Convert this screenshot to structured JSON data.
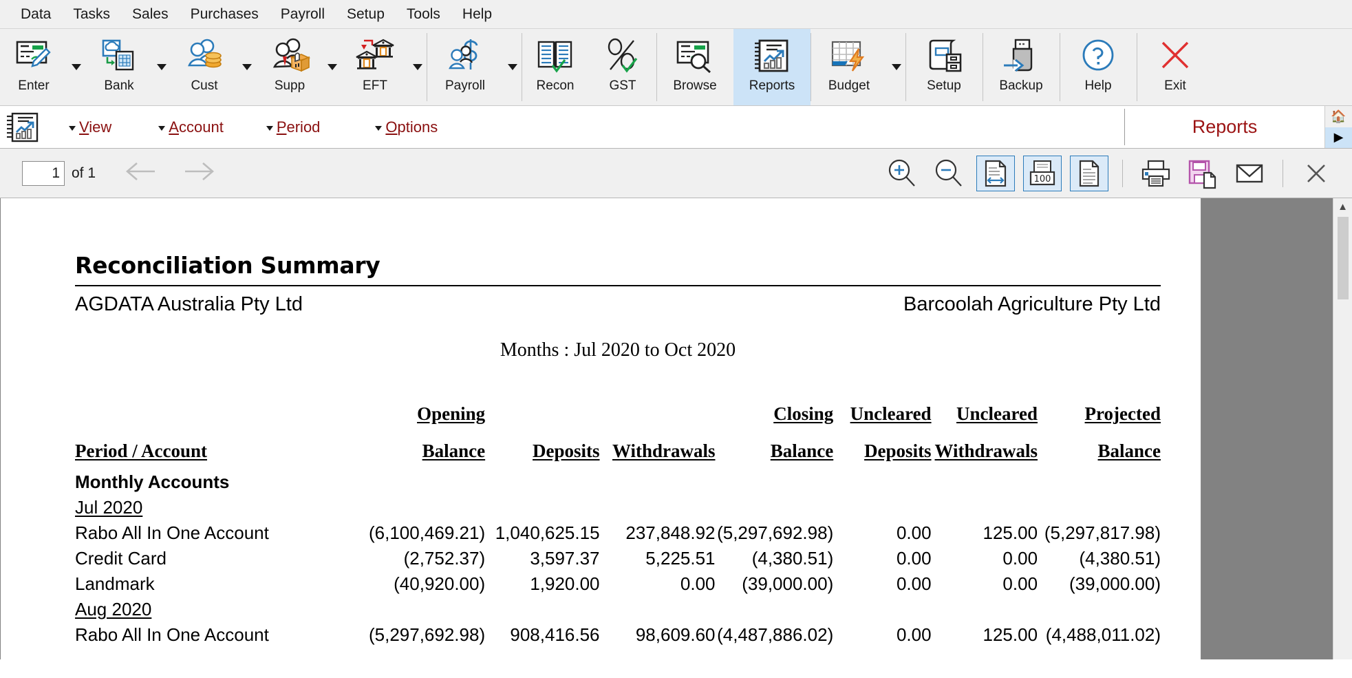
{
  "menubar": {
    "items": [
      {
        "label": "Data"
      },
      {
        "label": "Tasks"
      },
      {
        "label": "Sales"
      },
      {
        "label": "Purchases"
      },
      {
        "label": "Payroll"
      },
      {
        "label": "Setup"
      },
      {
        "label": "Tools"
      },
      {
        "label": "Help"
      }
    ]
  },
  "ribbon": {
    "buttons": [
      {
        "label": "Enter",
        "icon": "cheque-pencil-icon",
        "caret": true,
        "active": false
      },
      {
        "label": "Bank",
        "icon": "cloud-spreadsheet-icon",
        "caret": true,
        "active": false
      },
      {
        "label": "Cust",
        "icon": "people-coins-icon",
        "caret": true,
        "active": false
      },
      {
        "label": "Supp",
        "icon": "person-box-icon",
        "caret": true,
        "active": false
      },
      {
        "label": "EFT",
        "icon": "bank-transfer-icon",
        "caret": true,
        "active": false
      },
      {
        "label": "Payroll",
        "icon": "dollar-person-icon",
        "caret": true,
        "active": false
      },
      {
        "label": "Recon",
        "icon": "book-check-icon",
        "caret": false,
        "active": false
      },
      {
        "label": "GST",
        "icon": "percent-check-icon",
        "caret": false,
        "active": false
      },
      {
        "label": "Browse",
        "icon": "cheque-magnifier-icon",
        "caret": false,
        "active": false
      },
      {
        "label": "Reports",
        "icon": "report-chart-icon",
        "caret": false,
        "active": true
      },
      {
        "label": "Budget",
        "icon": "grid-lightning-icon",
        "caret": true,
        "active": false
      },
      {
        "label": "Setup",
        "icon": "book-cabinet-icon",
        "caret": false,
        "active": false
      },
      {
        "label": "Backup",
        "icon": "usb-arrow-icon",
        "caret": false,
        "active": false
      },
      {
        "label": "Help",
        "icon": "question-circle-icon",
        "caret": false,
        "active": false
      },
      {
        "label": "Exit",
        "icon": "close-x-icon",
        "caret": false,
        "active": false
      }
    ],
    "accent_blue": "#2b7bba",
    "active_bg": "#cce3f7"
  },
  "submenu": {
    "items": [
      {
        "mnemonic": "V",
        "rest": "iew"
      },
      {
        "mnemonic": "A",
        "rest": "ccount"
      },
      {
        "mnemonic": "P",
        "rest": "eriod"
      },
      {
        "mnemonic": "O",
        "rest": "ptions"
      }
    ],
    "title": "Reports",
    "title_color": "#9b1313",
    "rail": {
      "home_icon": "home-icon",
      "expand_icon": "chevron-right-icon",
      "collapse_icon": "chevron-left-icon"
    }
  },
  "viewer": {
    "page_number": "1",
    "page_count_label": "of 1",
    "prev_icon": "arrow-left-icon",
    "next_icon": "arrow-right-icon",
    "buttons": [
      {
        "name": "zoom-in-icon"
      },
      {
        "name": "zoom-out-icon"
      },
      {
        "name": "fit-width-icon"
      },
      {
        "name": "zoom-100-icon",
        "label": "100"
      },
      {
        "name": "fit-page-icon"
      },
      {
        "name": "print-icon"
      },
      {
        "name": "save-icon"
      },
      {
        "name": "email-icon"
      },
      {
        "name": "close-icon"
      }
    ]
  },
  "report": {
    "title": "Reconciliation Summary",
    "company": "AGDATA Australia Pty Ltd",
    "client": "Barcoolah Agriculture Pty Ltd",
    "months": "Months : Jul 2020 to Oct 2020",
    "columns": [
      {
        "line1": "",
        "line2": "Period / Account",
        "align": "left"
      },
      {
        "line1": "Opening",
        "line2": "Balance",
        "align": "right"
      },
      {
        "line1": "",
        "line2": "Deposits",
        "align": "right"
      },
      {
        "line1": "",
        "line2": "Withdrawals",
        "align": "right"
      },
      {
        "line1": "Closing",
        "line2": "Balance",
        "align": "right"
      },
      {
        "line1": "Uncleared",
        "line2": "Deposits",
        "align": "right"
      },
      {
        "line1": "Uncleared",
        "line2": "Withdrawals",
        "align": "right"
      },
      {
        "line1": "Projected",
        "line2": "Balance",
        "align": "right"
      }
    ],
    "group_label": "Monthly Accounts",
    "rows": [
      {
        "type": "period",
        "label": "Jul 2020"
      },
      {
        "type": "account",
        "label": "Rabo All In One Account",
        "opening": "(6,100,469.21)",
        "deposits": "1,040,625.15",
        "withdrawals": "237,848.92",
        "closing": "(5,297,692.98)",
        "uncleared_deposits": "0.00",
        "uncleared_withdrawals": "125.00",
        "projected": "(5,297,817.98)"
      },
      {
        "type": "account",
        "label": "Credit Card",
        "opening": "(2,752.37)",
        "deposits": "3,597.37",
        "withdrawals": "5,225.51",
        "closing": "(4,380.51)",
        "uncleared_deposits": "0.00",
        "uncleared_withdrawals": "0.00",
        "projected": "(4,380.51)"
      },
      {
        "type": "account",
        "label": "Landmark",
        "opening": "(40,920.00)",
        "deposits": "1,920.00",
        "withdrawals": "0.00",
        "closing": "(39,000.00)",
        "uncleared_deposits": "0.00",
        "uncleared_withdrawals": "0.00",
        "projected": "(39,000.00)"
      },
      {
        "type": "period",
        "label": "Aug 2020"
      },
      {
        "type": "account",
        "label": "Rabo All In One Account",
        "opening": "(5,297,692.98)",
        "deposits": "908,416.56",
        "withdrawals": "98,609.60",
        "closing": "(4,487,886.02)",
        "uncleared_deposits": "0.00",
        "uncleared_withdrawals": "125.00",
        "projected": "(4,488,011.02)"
      }
    ]
  }
}
